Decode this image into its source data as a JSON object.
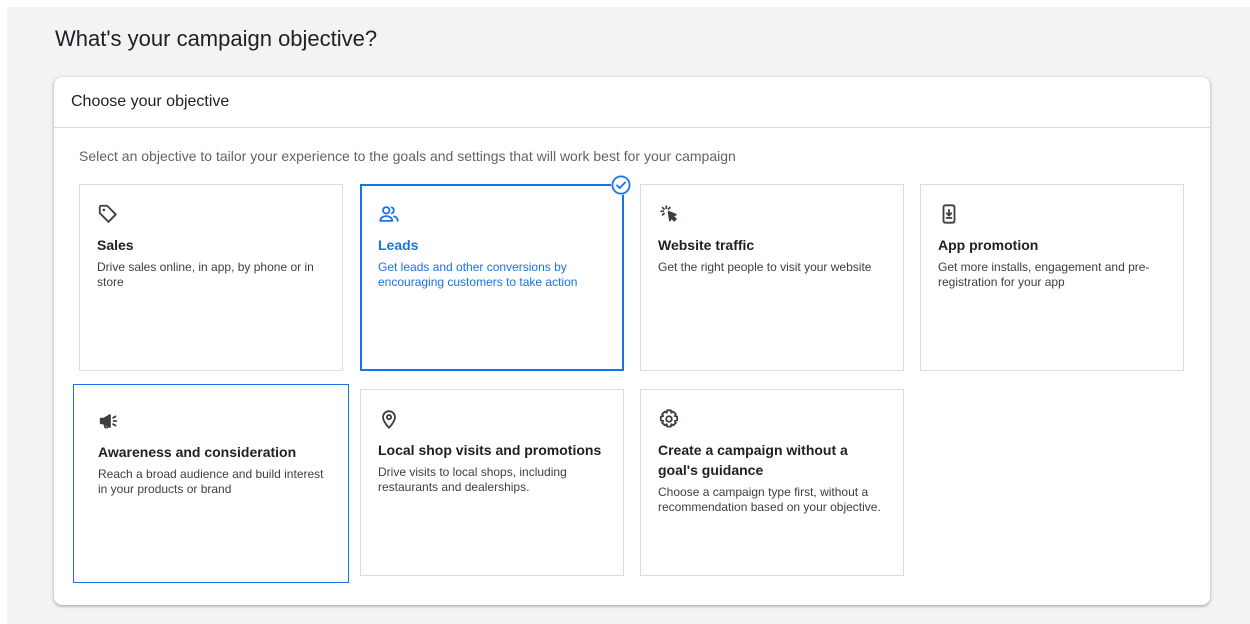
{
  "page": {
    "title": "What's your campaign objective?"
  },
  "card": {
    "header": "Choose your objective",
    "subtitle": "Select an objective to tailor your experience to the goals and settings that will work best for your campaign"
  },
  "colors": {
    "accent": "#1a73e8",
    "background": "#f1f3f4",
    "border": "#dadce0"
  },
  "objectives": [
    {
      "icon": "tag-icon",
      "title": "Sales",
      "description": "Drive sales online, in app, by phone or in store",
      "selected": false
    },
    {
      "icon": "people-icon",
      "title": "Leads",
      "description": "Get leads and other conversions by encouraging customers to take action",
      "selected": true
    },
    {
      "icon": "cursor-click-icon",
      "title": "Website traffic",
      "description": "Get the right people to visit your website",
      "selected": false
    },
    {
      "icon": "phone-download-icon",
      "title": "App promotion",
      "description": "Get more installs, engagement and pre-registration for your app",
      "selected": false
    },
    {
      "icon": "megaphone-icon",
      "title": "Awareness and consideration",
      "description": "Reach a broad audience and build interest in your products or brand",
      "selected": false
    },
    {
      "icon": "location-pin-icon",
      "title": "Local shop visits and promotions",
      "description": "Drive visits to local shops, including restaurants and dealerships.",
      "selected": false
    },
    {
      "icon": "gear-icon",
      "title": "Create a campaign without a goal's guidance",
      "description": "Choose a campaign type first, without a recommendation based on your objective.",
      "selected": false
    }
  ]
}
